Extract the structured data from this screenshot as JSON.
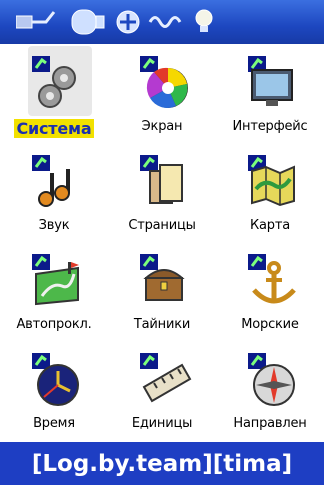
{
  "statusbar": {
    "icons": [
      "usb-cable-icon",
      "battery-icon",
      "satellite-icon",
      "signal-wave-icon",
      "backlight-bulb-icon"
    ]
  },
  "menu": {
    "selected": "Система",
    "items": [
      {
        "label": "Система",
        "icon": "gears-icon"
      },
      {
        "label": "Экран",
        "icon": "color-wheel-icon"
      },
      {
        "label": "Интерфейс",
        "icon": "monitor-icon"
      },
      {
        "label": "Звук",
        "icon": "music-notes-icon"
      },
      {
        "label": "Страницы",
        "icon": "pages-icon"
      },
      {
        "label": "Карта",
        "icon": "map-icon"
      },
      {
        "label": "Автопрокл.",
        "icon": "route-map-icon"
      },
      {
        "label": "Тайники",
        "icon": "treasure-chest-icon"
      },
      {
        "label": "Морские",
        "icon": "anchor-icon"
      },
      {
        "label": "Время",
        "icon": "clock-icon"
      },
      {
        "label": "Единицы",
        "icon": "ruler-icon"
      },
      {
        "label": "Направлен",
        "icon": "compass-icon"
      }
    ]
  },
  "footer": {
    "text": "[Log.by.team][tima]"
  },
  "colors": {
    "statusbar_bg": "#1d47c0",
    "footer_bg": "#1e3ec3",
    "selected_bg": "#f2e100",
    "selected_text": "#1a2fb0"
  }
}
